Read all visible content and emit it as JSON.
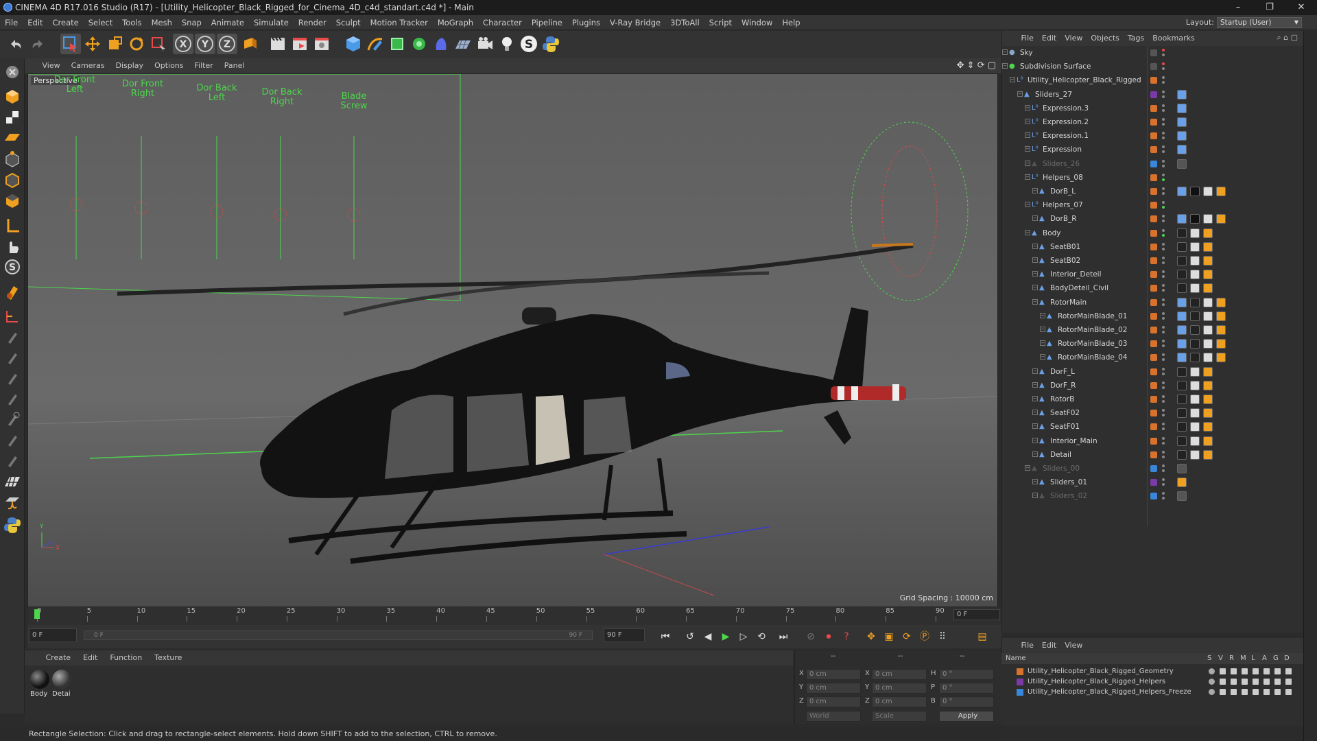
{
  "window": {
    "title": "CINEMA 4D R17.016 Studio (R17) - [Utility_Helicopter_Black_Rigged_for_Cinema_4D_c4d_standart.c4d *] - Main",
    "controls": [
      "–",
      "❐",
      "✕"
    ]
  },
  "menubar": {
    "items": [
      "File",
      "Edit",
      "Create",
      "Select",
      "Tools",
      "Mesh",
      "Snap",
      "Animate",
      "Simulate",
      "Render",
      "Sculpt",
      "Motion Tracker",
      "MoGraph",
      "Character",
      "Pipeline",
      "Plugins",
      "V-Ray Bridge",
      "3DToAll",
      "Script",
      "Window",
      "Help"
    ],
    "layout_label": "Layout:",
    "layout_value": "Startup (User)"
  },
  "viewport": {
    "menu": [
      "View",
      "Cameras",
      "Display",
      "Options",
      "Filter",
      "Panel"
    ],
    "label": "Perspective",
    "grid_spacing": "Grid Spacing : 10000 cm",
    "slider_labels": [
      "Dor Front Left",
      "Dor Front Right",
      "Dor Back Left",
      "Dor Back Right",
      "Blade Screw"
    ],
    "axis_labels": [
      "Y",
      "Z",
      "X"
    ]
  },
  "timeline": {
    "ticks": [
      "0",
      "5",
      "10",
      "15",
      "20",
      "25",
      "30",
      "35",
      "40",
      "45",
      "50",
      "55",
      "60",
      "65",
      "70",
      "75",
      "80",
      "85",
      "90"
    ],
    "end_frame": "0 F",
    "current": "0 F",
    "range_start": "0 F",
    "range_end": "90 F",
    "max": "90 F",
    "range_start_inner": "0 F"
  },
  "material_manager": {
    "menu": [
      "Create",
      "Edit",
      "Function",
      "Texture"
    ],
    "materials": [
      {
        "name": "Body"
      },
      {
        "name": "Detai"
      }
    ]
  },
  "coordinates": {
    "rows": [
      {
        "axis": "X",
        "pos": "0 cm",
        "axis2": "X",
        "size": "0 cm",
        "rot_label": "H",
        "rot": "0 °"
      },
      {
        "axis": "Y",
        "pos": "0 cm",
        "axis2": "Y",
        "size": "0 cm",
        "rot_label": "P",
        "rot": "0 °"
      },
      {
        "axis": "Z",
        "pos": "0 cm",
        "axis2": "Z",
        "size": "0 cm",
        "rot_label": "B",
        "rot": "0 °"
      }
    ],
    "col_headers": [
      "--",
      "--",
      "--"
    ],
    "mode1": "World",
    "mode2": "Scale",
    "apply": "Apply"
  },
  "status": "Rectangle Selection: Click and drag to rectangle-select elements. Hold down SHIFT to add to the selection, CTRL to remove.",
  "object_manager": {
    "menu": [
      "File",
      "Edit",
      "View",
      "Objects",
      "Tags",
      "Bookmarks"
    ],
    "objects": [
      {
        "name": "Sky",
        "indent": 0,
        "dim": false,
        "layer": "none"
      },
      {
        "name": "Subdivision Surface",
        "indent": 0,
        "dim": false,
        "layer": "none"
      },
      {
        "name": "Utility_Helicopter_Black_Rigged",
        "indent": 1,
        "dim": false,
        "layer": "orange"
      },
      {
        "name": "Sliders_27",
        "indent": 2,
        "dim": false,
        "layer": "purple"
      },
      {
        "name": "Expression.3",
        "indent": 3,
        "dim": false,
        "layer": "orange"
      },
      {
        "name": "Expression.2",
        "indent": 3,
        "dim": false,
        "layer": "orange"
      },
      {
        "name": "Expression.1",
        "indent": 3,
        "dim": false,
        "layer": "orange"
      },
      {
        "name": "Expression",
        "indent": 3,
        "dim": false,
        "layer": "orange"
      },
      {
        "name": "Sliders_26",
        "indent": 3,
        "dim": true,
        "layer": "blue"
      },
      {
        "name": "Helpers_08",
        "indent": 3,
        "dim": false,
        "layer": "orange"
      },
      {
        "name": "DorB_L",
        "indent": 4,
        "dim": false,
        "layer": "orange"
      },
      {
        "name": "Helpers_07",
        "indent": 3,
        "dim": false,
        "layer": "orange"
      },
      {
        "name": "DorB_R",
        "indent": 4,
        "dim": false,
        "layer": "orange"
      },
      {
        "name": "Body",
        "indent": 3,
        "dim": false,
        "layer": "orange"
      },
      {
        "name": "SeatB01",
        "indent": 4,
        "dim": false,
        "layer": "orange"
      },
      {
        "name": "SeatB02",
        "indent": 4,
        "dim": false,
        "layer": "orange"
      },
      {
        "name": "Interior_Deteil",
        "indent": 4,
        "dim": false,
        "layer": "orange"
      },
      {
        "name": "BodyDeteil_Civil",
        "indent": 4,
        "dim": false,
        "layer": "orange"
      },
      {
        "name": "RotorMain",
        "indent": 4,
        "dim": false,
        "layer": "orange"
      },
      {
        "name": "RotorMainBlade_01",
        "indent": 5,
        "dim": false,
        "layer": "orange"
      },
      {
        "name": "RotorMainBlade_02",
        "indent": 5,
        "dim": false,
        "layer": "orange"
      },
      {
        "name": "RotorMainBlade_03",
        "indent": 5,
        "dim": false,
        "layer": "orange"
      },
      {
        "name": "RotorMainBlade_04",
        "indent": 5,
        "dim": false,
        "layer": "orange"
      },
      {
        "name": "DorF_L",
        "indent": 4,
        "dim": false,
        "layer": "orange"
      },
      {
        "name": "DorF_R",
        "indent": 4,
        "dim": false,
        "layer": "orange"
      },
      {
        "name": "RotorB",
        "indent": 4,
        "dim": false,
        "layer": "orange"
      },
      {
        "name": "SeatF02",
        "indent": 4,
        "dim": false,
        "layer": "orange"
      },
      {
        "name": "SeatF01",
        "indent": 4,
        "dim": false,
        "layer": "orange"
      },
      {
        "name": "Interior_Main",
        "indent": 4,
        "dim": false,
        "layer": "orange"
      },
      {
        "name": "Detail",
        "indent": 4,
        "dim": false,
        "layer": "orange"
      },
      {
        "name": "Sliders_00",
        "indent": 3,
        "dim": true,
        "layer": "blue"
      },
      {
        "name": "Sliders_01",
        "indent": 4,
        "dim": false,
        "layer": "purple"
      },
      {
        "name": "Sliders_02",
        "indent": 4,
        "dim": true,
        "layer": "blue"
      }
    ]
  },
  "layer_manager": {
    "menu": [
      "File",
      "Edit",
      "View"
    ],
    "header": {
      "name": "Name",
      "cols": [
        "S",
        "V",
        "R",
        "M",
        "L",
        "A",
        "G",
        "D"
      ]
    },
    "layers": [
      {
        "name": "Utility_Helicopter_Black_Rigged_Geometry",
        "color": "#d8722c"
      },
      {
        "name": "Utility_Helicopter_Black_Rigged_Helpers",
        "color": "#7a3aa8"
      },
      {
        "name": "Utility_Helicopter_Black_Rigged_Helpers_Freeze",
        "color": "#3a86d8"
      }
    ]
  },
  "colors": {
    "orange": "#d8722c",
    "purple": "#7a3aa8",
    "blue": "#3a86d8",
    "accent_green": "#4cd64c"
  }
}
